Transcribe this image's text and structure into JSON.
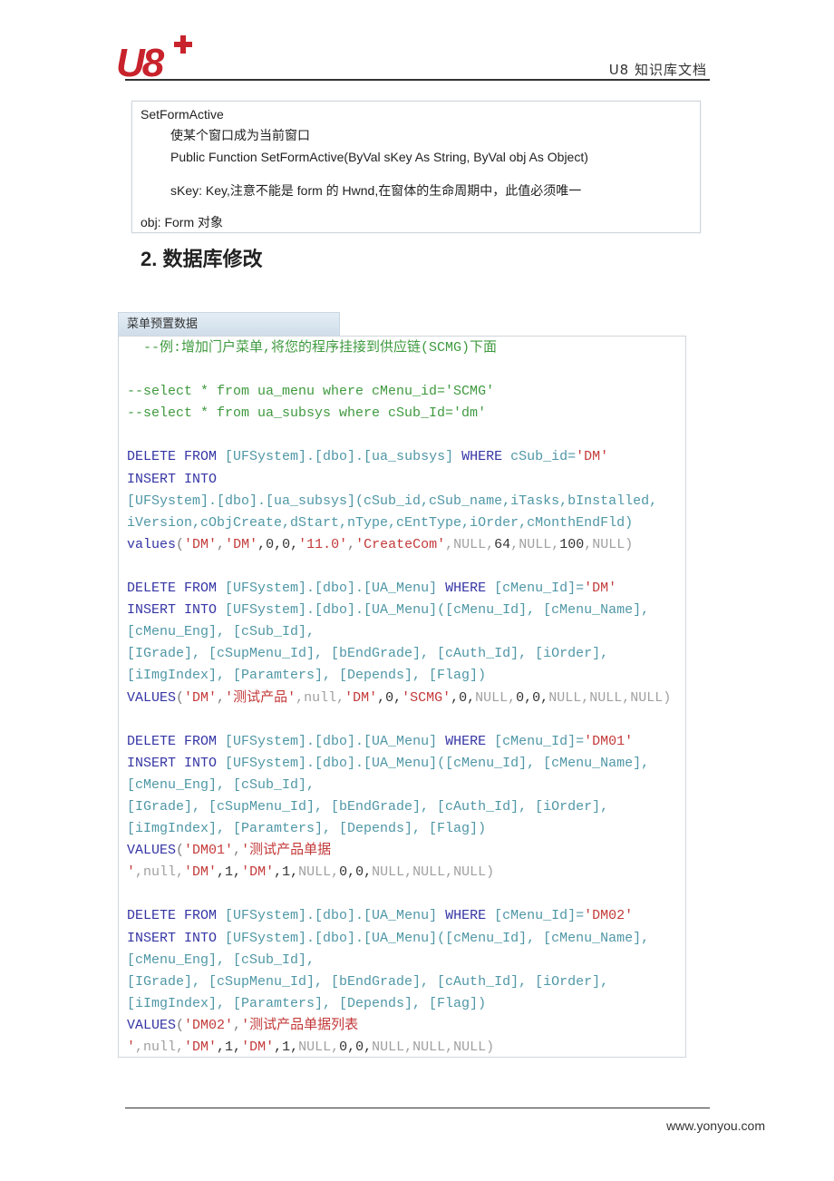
{
  "header": {
    "logo_text": "U8+",
    "title": "U8 知识库文档",
    "brand_color": "#c8232c"
  },
  "api": {
    "name": "SetFormActive",
    "description": "使某个窗口成为当前窗口",
    "signature": "Public Function SetFormActive(ByVal sKey As String, ByVal obj As Object)",
    "param_skey": "sKey: Key,注意不能是 form 的 Hwnd,在窗体的生命周期中，此值必须唯一",
    "param_obj": "obj: Form 对象"
  },
  "section": {
    "heading": "2.  数据库修改"
  },
  "code": {
    "title": "菜单预置数据",
    "lines": [
      [
        [
          "c",
          "  --例:增加门户菜单,将您的程序挂接到供应链(SCMG)下面"
        ]
      ],
      [],
      [
        [
          "c",
          "--select * from ua_menu where cMenu_id='SCMG'"
        ]
      ],
      [
        [
          "c",
          "--select * from ua_subsys where cSub_Id='dm'"
        ]
      ],
      [],
      [
        [
          "k",
          "DELETE FROM "
        ],
        [
          "i",
          "[UFSystem].[dbo].[ua_subsys] "
        ],
        [
          "k",
          "WHERE "
        ],
        [
          "i",
          "cSub_id="
        ],
        [
          "s",
          "'DM'"
        ]
      ],
      [
        [
          "k",
          "INSERT INTO"
        ]
      ],
      [
        [
          "i",
          "[UFSystem].[dbo].[ua_subsys](cSub_id,cSub_name,iTasks,bInstalled,"
        ]
      ],
      [
        [
          "i",
          "iVersion,cObjCreate,dStart,nType,cEntType,iOrder,cMonthEndFld)"
        ]
      ],
      [
        [
          "k",
          "values"
        ],
        [
          "p",
          "("
        ],
        [
          "s",
          "'DM'"
        ],
        [
          "p",
          ","
        ],
        [
          "s",
          "'DM'"
        ],
        [
          "d",
          ",0,0,"
        ],
        [
          "s",
          "'11.0'"
        ],
        [
          "p",
          ","
        ],
        [
          "s",
          "'CreateCom'"
        ],
        [
          "n",
          ",NULL,"
        ],
        [
          "d",
          "64"
        ],
        [
          "n",
          ",NULL,"
        ],
        [
          "d",
          "100"
        ],
        [
          "n",
          ",NULL)"
        ]
      ],
      [],
      [
        [
          "k",
          "DELETE FROM "
        ],
        [
          "i",
          "[UFSystem].[dbo].[UA_Menu] "
        ],
        [
          "k",
          "WHERE "
        ],
        [
          "i",
          "[cMenu_Id]="
        ],
        [
          "s",
          "'DM'"
        ]
      ],
      [
        [
          "k",
          "INSERT INTO "
        ],
        [
          "i",
          "[UFSystem].[dbo].[UA_Menu]([cMenu_Id], [cMenu_Name],"
        ]
      ],
      [
        [
          "i",
          "[cMenu_Eng], [cSub_Id],"
        ]
      ],
      [
        [
          "i",
          "[IGrade], [cSupMenu_Id], [bEndGrade], [cAuth_Id], [iOrder],"
        ]
      ],
      [
        [
          "i",
          "[iImgIndex], [Paramters], [Depends], [Flag])"
        ]
      ],
      [
        [
          "k",
          "VALUES"
        ],
        [
          "p",
          "("
        ],
        [
          "s",
          "'DM'"
        ],
        [
          "p",
          ","
        ],
        [
          "s",
          "'测试产品'"
        ],
        [
          "n",
          ",null,"
        ],
        [
          "s",
          "'DM'"
        ],
        [
          "d",
          ",0,"
        ],
        [
          "s",
          "'SCMG'"
        ],
        [
          "d",
          ",0,"
        ],
        [
          "n",
          "NULL,"
        ],
        [
          "d",
          "0,0,"
        ],
        [
          "n",
          "NULL,NULL,NULL)"
        ]
      ],
      [],
      [
        [
          "k",
          "DELETE FROM "
        ],
        [
          "i",
          "[UFSystem].[dbo].[UA_Menu] "
        ],
        [
          "k",
          "WHERE "
        ],
        [
          "i",
          "[cMenu_Id]="
        ],
        [
          "s",
          "'DM01'"
        ]
      ],
      [
        [
          "k",
          "INSERT INTO "
        ],
        [
          "i",
          "[UFSystem].[dbo].[UA_Menu]([cMenu_Id], [cMenu_Name],"
        ]
      ],
      [
        [
          "i",
          "[cMenu_Eng], [cSub_Id],"
        ]
      ],
      [
        [
          "i",
          "[IGrade], [cSupMenu_Id], [bEndGrade], [cAuth_Id], [iOrder],"
        ]
      ],
      [
        [
          "i",
          "[iImgIndex], [Paramters], [Depends], [Flag])"
        ]
      ],
      [
        [
          "k",
          "VALUES"
        ],
        [
          "p",
          "("
        ],
        [
          "s",
          "'DM01'"
        ],
        [
          "p",
          ","
        ],
        [
          "s",
          "'测试产品单据"
        ]
      ],
      [
        [
          "s",
          "'"
        ],
        [
          "n",
          ",null,"
        ],
        [
          "s",
          "'DM'"
        ],
        [
          "d",
          ",1,"
        ],
        [
          "s",
          "'DM'"
        ],
        [
          "d",
          ",1,"
        ],
        [
          "n",
          "NULL,"
        ],
        [
          "d",
          "0,0,"
        ],
        [
          "n",
          "NULL,NULL,NULL)"
        ]
      ],
      [],
      [
        [
          "k",
          "DELETE FROM "
        ],
        [
          "i",
          "[UFSystem].[dbo].[UA_Menu] "
        ],
        [
          "k",
          "WHERE "
        ],
        [
          "i",
          "[cMenu_Id]="
        ],
        [
          "s",
          "'DM02'"
        ]
      ],
      [
        [
          "k",
          "INSERT INTO "
        ],
        [
          "i",
          "[UFSystem].[dbo].[UA_Menu]([cMenu_Id], [cMenu_Name],"
        ]
      ],
      [
        [
          "i",
          "[cMenu_Eng], [cSub_Id],"
        ]
      ],
      [
        [
          "i",
          "[IGrade], [cSupMenu_Id], [bEndGrade], [cAuth_Id], [iOrder],"
        ]
      ],
      [
        [
          "i",
          "[iImgIndex], [Paramters], [Depends], [Flag])"
        ]
      ],
      [
        [
          "k",
          "VALUES"
        ],
        [
          "p",
          "("
        ],
        [
          "s",
          "'DM02'"
        ],
        [
          "p",
          ","
        ],
        [
          "s",
          "'测试产品单据列表"
        ]
      ],
      [
        [
          "s",
          "'"
        ],
        [
          "n",
          ",null,"
        ],
        [
          "s",
          "'DM'"
        ],
        [
          "d",
          ",1,"
        ],
        [
          "s",
          "'DM'"
        ],
        [
          "d",
          ",1,"
        ],
        [
          "n",
          "NULL,"
        ],
        [
          "d",
          "0,0,"
        ],
        [
          "n",
          "NULL,NULL,NULL)"
        ]
      ]
    ]
  },
  "footer": {
    "url": "www.yonyou.com"
  }
}
